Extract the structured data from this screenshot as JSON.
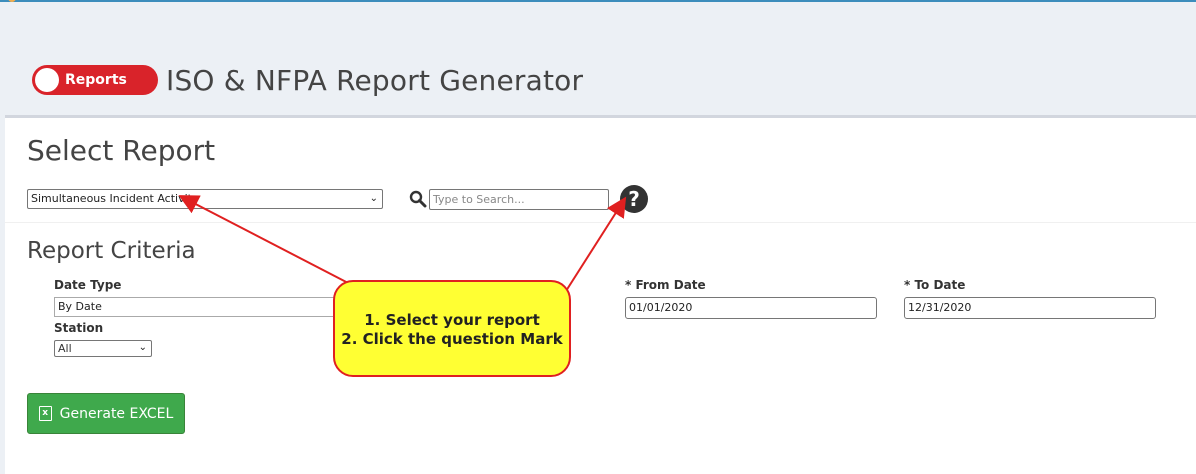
{
  "header": {
    "toggle_label": "Reports",
    "title": "ISO & NFPA Report Generator"
  },
  "select_report": {
    "title": "Select Report",
    "selected": "Simultaneous Incident Activity",
    "search_placeholder": "Type to Search...",
    "help_icon": "question-circle-icon"
  },
  "criteria": {
    "title": "Report Criteria",
    "date_type_label": "Date Type",
    "date_type_value": "By Date",
    "station_label": "Station",
    "station_value": "All",
    "from_label": "* From Date",
    "from_value": "01/01/2020",
    "to_label": "* To Date",
    "to_value": "12/31/2020"
  },
  "actions": {
    "generate_label": "Generate EXCEL"
  },
  "annotation": {
    "line1": "1. Select your report",
    "line2": "2. Click the question Mark"
  },
  "colors": {
    "toggle": "#d9232a",
    "button": "#3fa94c",
    "callout_fill": "#ffff33",
    "callout_border": "#e02020"
  }
}
